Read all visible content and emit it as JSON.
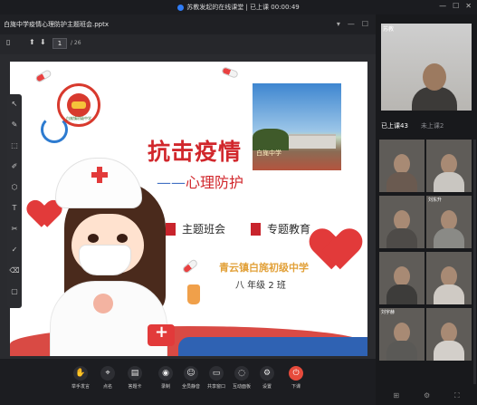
{
  "titlebar": {
    "title": "苏教发起的在线课堂 | 已上课 00:00:49",
    "controls": [
      "—",
      "☐",
      "✕"
    ]
  },
  "share_window": {
    "file_name": "白旄中学疫情心理防护主题班会.pptx",
    "header_controls": [
      "▾",
      "—",
      "☐"
    ],
    "toolbar": {
      "page_current": "1",
      "page_total": "/ 26"
    }
  },
  "annotation_tools": [
    "↖",
    "✎",
    "⬚",
    "✐",
    "⬡",
    "T",
    "✂",
    "✓",
    "⌫",
    "▢"
  ],
  "slide": {
    "logo_text": "白旄镇初级中学",
    "photo_sign": "白旄中学",
    "main_title": "抗击疫情",
    "subtitle_dash": "——",
    "subtitle": "心理防护",
    "tag_left": "主题班会",
    "tag_right": "专题教育",
    "school": "青云镇白旄初级中学",
    "class": "八 年级 2 班"
  },
  "bottom_bar": [
    {
      "icon": "✋",
      "label": "举手发言",
      "name": "raise-hand-button"
    },
    {
      "icon": "⌖",
      "label": "点名",
      "name": "roll-call-button"
    },
    {
      "icon": "▤",
      "label": "答题卡",
      "name": "answer-card-button"
    },
    {
      "icon": "◉",
      "label": "录制",
      "name": "record-button"
    },
    {
      "icon": "☺",
      "label": "全员静音",
      "name": "mute-all-button"
    },
    {
      "icon": "▭",
      "label": "共享窗口",
      "name": "share-window-button"
    },
    {
      "icon": "◌",
      "label": "互动面板",
      "name": "interaction-panel-button"
    },
    {
      "icon": "⚙",
      "label": "设置",
      "name": "settings-button"
    },
    {
      "icon": "⏻",
      "label": "下课",
      "name": "end-class-button"
    }
  ],
  "right_panel": {
    "teacher_label": "苏教",
    "tabs": [
      {
        "label": "已上课43",
        "active": true
      },
      {
        "label": "未上课2",
        "active": false
      }
    ],
    "students": [
      {
        "label": "",
        "color": "#6a5a50"
      },
      {
        "label": "",
        "color": "#c9c6c1"
      },
      {
        "label": "",
        "color": "#4e4b48"
      },
      {
        "label": "刘东升",
        "color": "#8a8a86"
      },
      {
        "label": "",
        "color": "#3d3c3a"
      },
      {
        "label": "",
        "color": "#cfcac4"
      },
      {
        "label": "刘宇赫",
        "color": "#5a5956"
      },
      {
        "label": "",
        "color": "#d3cfca"
      }
    ],
    "bottom_icons": [
      "⊞",
      "⚙",
      "⛶"
    ]
  }
}
